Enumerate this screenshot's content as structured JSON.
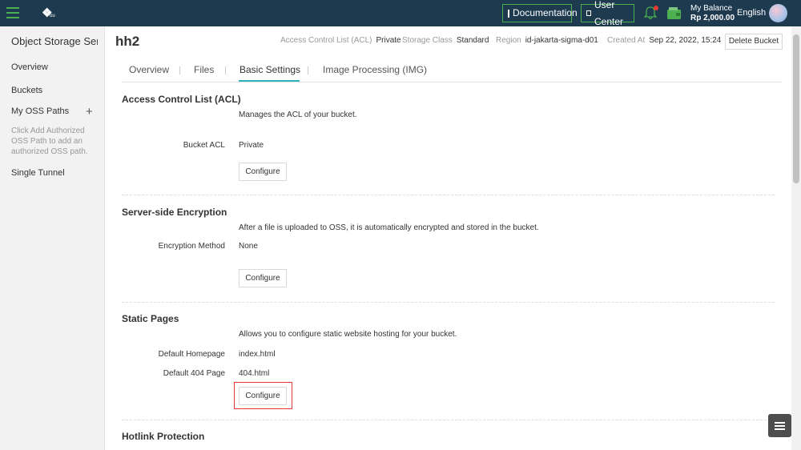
{
  "topbar": {
    "logo_text": "Pou",
    "documentation_label": "Documentation",
    "user_center_label": "User Center",
    "balance_label": "My Balance",
    "balance_value": "Rp 2,000.00",
    "language": "English",
    "accent_color": "#4caf50",
    "background_color": "#1d3a4f"
  },
  "sidebar": {
    "title": "Object Storage Ser...",
    "items": [
      {
        "label": "Overview"
      },
      {
        "label": "Buckets"
      },
      {
        "label": "My OSS Paths"
      },
      {
        "label": "Single Tunnel"
      }
    ],
    "add_icon": "+",
    "hint": "Click Add Authorized OSS Path to add an authorized OSS path."
  },
  "header": {
    "bucket_name": "hh2",
    "acl_key": "Access Control List (ACL)",
    "acl_value": "Private",
    "storage_class_key": "Storage Class",
    "storage_class_value": "Standard",
    "region_key": "Region",
    "region_value": "id-jakarta-sigma-d01",
    "created_key": "Created At",
    "created_value": "Sep 22, 2022, 15:24",
    "delete_label": "Delete Bucket"
  },
  "tabs": [
    {
      "label": "Overview",
      "active": false
    },
    {
      "label": "Files",
      "active": false
    },
    {
      "label": "Basic Settings",
      "active": true
    },
    {
      "label": "Image Processing (IMG)",
      "active": false
    }
  ],
  "sections": {
    "acl": {
      "title": "Access Control List (ACL)",
      "description": "Manages the ACL of your bucket.",
      "label": "Bucket ACL",
      "value": "Private",
      "button": "Configure"
    },
    "encryption": {
      "title": "Server-side Encryption",
      "description": "After a file is uploaded to OSS, it is automatically encrypted and stored in the bucket.",
      "label": "Encryption Method",
      "value": "None",
      "button": "Configure"
    },
    "static_pages": {
      "title": "Static Pages",
      "description": "Allows you to configure static website hosting for your bucket.",
      "homepage_label": "Default Homepage",
      "homepage_value": "index.html",
      "page404_label": "Default 404 Page",
      "page404_value": "404.html",
      "button": "Configure"
    },
    "hotlink": {
      "title": "Hotlink Protection"
    }
  },
  "colors": {
    "tab_active": "#2ab4c0",
    "highlight": "#e53935"
  }
}
